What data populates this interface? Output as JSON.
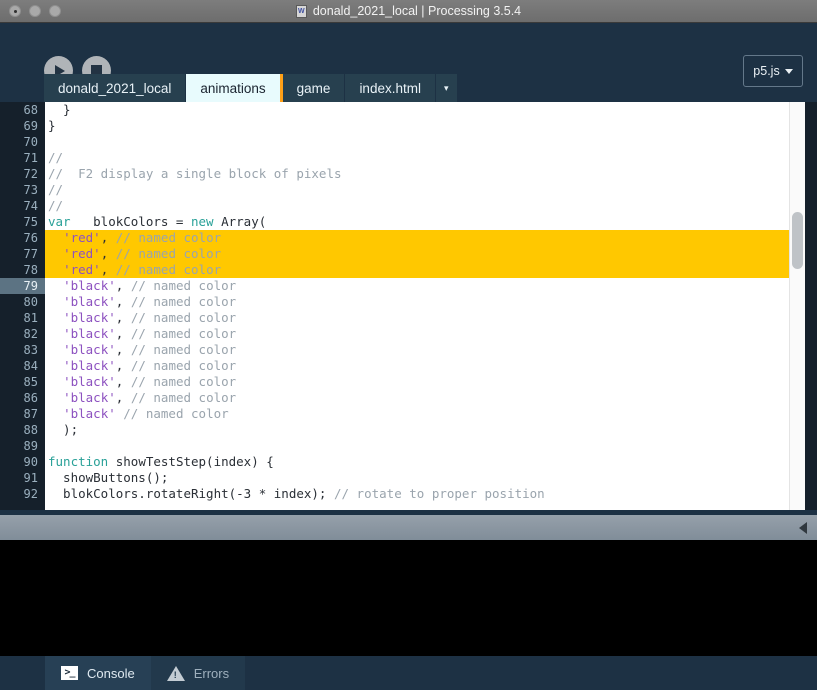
{
  "window": {
    "title": "donald_2021_local | Processing 3.5.4",
    "title_icon": "sketch-file-icon",
    "traffic_lights": [
      "close-button",
      "minimize-button",
      "zoom-button"
    ]
  },
  "toolbar": {
    "run_label": "Run",
    "stop_label": "Stop",
    "run_icon": "play-icon",
    "stop_icon": "stop-icon",
    "mode_label": "p5.js",
    "mode_caret_icon": "chevron-down-icon"
  },
  "tabs": {
    "items": [
      {
        "label": "donald_2021_local",
        "active": false
      },
      {
        "label": "animations",
        "active": true
      },
      {
        "label": "game",
        "active": false
      },
      {
        "label": "index.html",
        "active": false
      }
    ],
    "overflow_label": "▾"
  },
  "editor": {
    "first_line_number": 68,
    "current_line": 79,
    "highlighted_lines": [
      76,
      77,
      78
    ],
    "accent_highlight_color": "#ffc800",
    "active_tab_accent": "#ffa017",
    "lines": [
      {
        "n": 68,
        "tokens": [
          {
            "t": "  }",
            "c": "pl"
          }
        ]
      },
      {
        "n": 69,
        "tokens": [
          {
            "t": "}",
            "c": "pl"
          }
        ]
      },
      {
        "n": 70,
        "tokens": [
          {
            "t": "",
            "c": "pl"
          }
        ]
      },
      {
        "n": 71,
        "tokens": [
          {
            "t": "//",
            "c": "cmt"
          }
        ]
      },
      {
        "n": 72,
        "tokens": [
          {
            "t": "//  F2 display a single block of pixels",
            "c": "cmt"
          }
        ]
      },
      {
        "n": 73,
        "tokens": [
          {
            "t": "//",
            "c": "cmt"
          }
        ]
      },
      {
        "n": 74,
        "tokens": [
          {
            "t": "//",
            "c": "cmt"
          }
        ]
      },
      {
        "n": 75,
        "tokens": [
          {
            "t": "var",
            "c": "kw"
          },
          {
            "t": "   blokColors = ",
            "c": "pl"
          },
          {
            "t": "new",
            "c": "kw"
          },
          {
            "t": " Array(",
            "c": "pl"
          }
        ]
      },
      {
        "n": 76,
        "hl": true,
        "tokens": [
          {
            "t": "  ",
            "c": "pl"
          },
          {
            "t": "'red'",
            "c": "str"
          },
          {
            "t": ", ",
            "c": "pl"
          },
          {
            "t": "// named color",
            "c": "cmt"
          }
        ]
      },
      {
        "n": 77,
        "hl": true,
        "tokens": [
          {
            "t": "  ",
            "c": "pl"
          },
          {
            "t": "'red'",
            "c": "str"
          },
          {
            "t": ", ",
            "c": "pl"
          },
          {
            "t": "// named color",
            "c": "cmt"
          }
        ]
      },
      {
        "n": 78,
        "hl": true,
        "tokens": [
          {
            "t": "  ",
            "c": "pl"
          },
          {
            "t": "'red'",
            "c": "str"
          },
          {
            "t": ", ",
            "c": "pl"
          },
          {
            "t": "// named color",
            "c": "cmt"
          }
        ]
      },
      {
        "n": 79,
        "current": true,
        "tokens": [
          {
            "t": "  ",
            "c": "pl"
          },
          {
            "t": "'black'",
            "c": "str"
          },
          {
            "t": ", ",
            "c": "pl"
          },
          {
            "t": "// named color",
            "c": "cmt"
          }
        ]
      },
      {
        "n": 80,
        "tokens": [
          {
            "t": "  ",
            "c": "pl"
          },
          {
            "t": "'black'",
            "c": "str"
          },
          {
            "t": ", ",
            "c": "pl"
          },
          {
            "t": "// named color",
            "c": "cmt"
          }
        ]
      },
      {
        "n": 81,
        "tokens": [
          {
            "t": "  ",
            "c": "pl"
          },
          {
            "t": "'black'",
            "c": "str"
          },
          {
            "t": ", ",
            "c": "pl"
          },
          {
            "t": "// named color",
            "c": "cmt"
          }
        ]
      },
      {
        "n": 82,
        "tokens": [
          {
            "t": "  ",
            "c": "pl"
          },
          {
            "t": "'black'",
            "c": "str"
          },
          {
            "t": ", ",
            "c": "pl"
          },
          {
            "t": "// named color",
            "c": "cmt"
          }
        ]
      },
      {
        "n": 83,
        "tokens": [
          {
            "t": "  ",
            "c": "pl"
          },
          {
            "t": "'black'",
            "c": "str"
          },
          {
            "t": ", ",
            "c": "pl"
          },
          {
            "t": "// named color",
            "c": "cmt"
          }
        ]
      },
      {
        "n": 84,
        "tokens": [
          {
            "t": "  ",
            "c": "pl"
          },
          {
            "t": "'black'",
            "c": "str"
          },
          {
            "t": ", ",
            "c": "pl"
          },
          {
            "t": "// named color",
            "c": "cmt"
          }
        ]
      },
      {
        "n": 85,
        "tokens": [
          {
            "t": "  ",
            "c": "pl"
          },
          {
            "t": "'black'",
            "c": "str"
          },
          {
            "t": ", ",
            "c": "pl"
          },
          {
            "t": "// named color",
            "c": "cmt"
          }
        ]
      },
      {
        "n": 86,
        "tokens": [
          {
            "t": "  ",
            "c": "pl"
          },
          {
            "t": "'black'",
            "c": "str"
          },
          {
            "t": ", ",
            "c": "pl"
          },
          {
            "t": "// named color",
            "c": "cmt"
          }
        ]
      },
      {
        "n": 87,
        "tokens": [
          {
            "t": "  ",
            "c": "pl"
          },
          {
            "t": "'black'",
            "c": "str"
          },
          {
            "t": " ",
            "c": "pl"
          },
          {
            "t": "// named color",
            "c": "cmt"
          }
        ]
      },
      {
        "n": 88,
        "tokens": [
          {
            "t": "  );",
            "c": "pl"
          }
        ]
      },
      {
        "n": 89,
        "tokens": [
          {
            "t": "",
            "c": "pl"
          }
        ]
      },
      {
        "n": 90,
        "tokens": [
          {
            "t": "function",
            "c": "kw"
          },
          {
            "t": " showTestStep(index) {",
            "c": "pl"
          }
        ]
      },
      {
        "n": 91,
        "tokens": [
          {
            "t": "  showButtons();",
            "c": "pl"
          }
        ]
      },
      {
        "n": 92,
        "tokens": [
          {
            "t": "  blokColors.rotateRight(-3 * index); ",
            "c": "pl"
          },
          {
            "t": "// rotate to proper position",
            "c": "cmt"
          }
        ]
      }
    ],
    "scrollbar": {
      "name": "vertical-scrollbar",
      "thumb_top_pct": 27,
      "thumb_height_pct": 14
    }
  },
  "divider": {
    "collapse_icon": "collapse-left-arrow-icon"
  },
  "console": {
    "output": ""
  },
  "bottom_tabs": {
    "items": [
      {
        "label": "Console",
        "icon": "terminal-icon",
        "active": true
      },
      {
        "label": "Errors",
        "icon": "warning-triangle-icon",
        "active": false
      }
    ]
  }
}
